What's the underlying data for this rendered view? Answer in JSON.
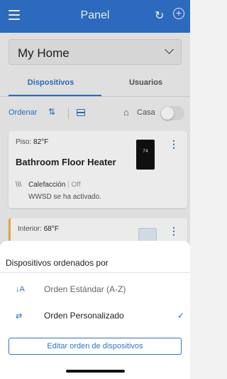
{
  "header": {
    "title": "Panel",
    "menu_icon": "menu-icon",
    "refresh_icon": "refresh-icon",
    "refresh_glyph": "C͑",
    "add_icon": "add-icon",
    "add_glyph": "+"
  },
  "location": {
    "selected": "My Home"
  },
  "tabs": [
    {
      "label": "Dispositivos",
      "active": true
    },
    {
      "label": "Usuarios",
      "active": false
    }
  ],
  "toolbar": {
    "sort_label": "Ordenar",
    "sort_glyph": "⮃",
    "home_label": "Casa",
    "home_glyph": "⌂"
  },
  "devices": [
    {
      "location_label": "Piso:",
      "temperature": "82°F",
      "name": "Bathroom Floor Heater",
      "mode": "Calefacción",
      "status": "Off",
      "note": "WWSD se ha activado.",
      "display_value": "74",
      "mode_glyph": "\\\\\\"
    },
    {
      "location_label": "Interior:",
      "temperature": "68°F"
    }
  ],
  "menu_glyph": "⋮",
  "sort_sheet": {
    "title": "Dispositivos ordenados por",
    "options": [
      {
        "label": "Orden Estándar (A-Z)",
        "glyph": "↓A"
      },
      {
        "label": "Orden Personalizado",
        "glyph": "⮃",
        "selected": true
      }
    ],
    "check_glyph": "✓",
    "button_label": "Editar orden de dispositivos"
  },
  "colors": {
    "primary": "#2f74cc",
    "accent_warm": "#f2b44a"
  }
}
